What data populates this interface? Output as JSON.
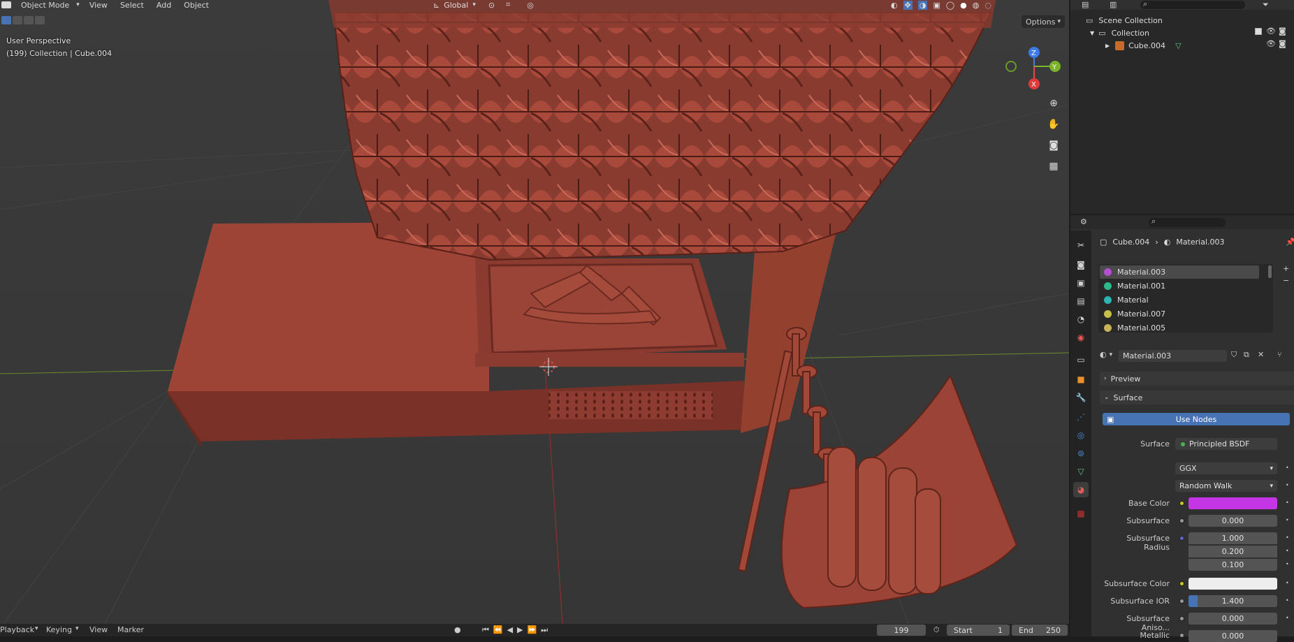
{
  "header": {
    "mode_label": "Object Mode",
    "menu": [
      "View",
      "Select",
      "Add",
      "Object"
    ],
    "transform_orientation": "Global"
  },
  "viewport": {
    "perspective_label": "User Perspective",
    "collection_label": "(199) Collection | Cube.004",
    "options_label": "Options",
    "gizmo": {
      "z": "Z",
      "y": "Y",
      "x": "X"
    }
  },
  "timeline": {
    "menu": [
      "Playback",
      "Keying",
      "View",
      "Marker"
    ],
    "current_frame": "199",
    "start_label": "Start",
    "start_value": "1",
    "end_label": "End",
    "end_value": "250"
  },
  "outliner": {
    "scene_collection": "Scene Collection",
    "collection": "Collection",
    "object": "Cube.004"
  },
  "properties": {
    "breadcrumb_object": "Cube.004",
    "breadcrumb_material": "Material.003",
    "material_slots": [
      {
        "name": "Material.003",
        "color": "#b44fcf"
      },
      {
        "name": "Material.001",
        "color": "#2fb889"
      },
      {
        "name": "Material",
        "color": "#2fb3b3"
      },
      {
        "name": "Material.007",
        "color": "#c7c04a"
      },
      {
        "name": "Material.005",
        "color": "#c7b35a"
      }
    ],
    "active_material": "Material.003",
    "preview_label": "Preview",
    "surface_section": "Surface",
    "use_nodes_label": "Use Nodes",
    "surface_label": "Surface",
    "surface_shader": "Principled BSDF",
    "distribution": "GGX",
    "subsurface_method": "Random Walk",
    "base_color_label": "Base Color",
    "base_color": "#c435e6",
    "subsurface_label": "Subsurface",
    "subsurface_value": "0.000",
    "subsurface_radius_label": "Subsurface Radius",
    "subsurface_radius": [
      "1.000",
      "0.200",
      "0.100"
    ],
    "subsurface_color_label": "Subsurface Color",
    "subsurface_color": "#eeeeee",
    "subsurface_ior_label": "Subsurface IOR",
    "subsurface_ior_value": "1.400",
    "subsurface_ior_fill": 0.1,
    "subsurface_aniso_label": "Subsurface Aniso...",
    "subsurface_aniso_value": "0.000",
    "metallic_label": "Metallic",
    "metallic_value": "0.000"
  }
}
